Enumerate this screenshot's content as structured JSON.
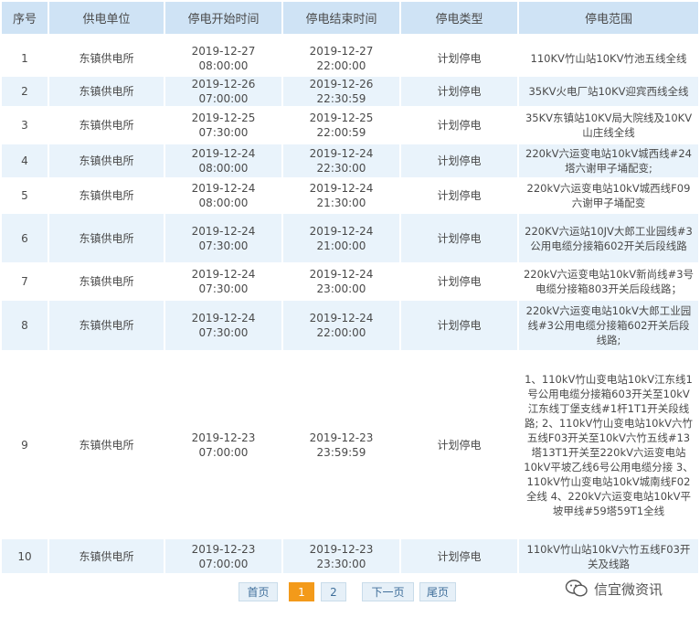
{
  "columns": [
    "序号",
    "供电单位",
    "停电开始时间",
    "停电结束时间",
    "停电类型",
    "停电范围"
  ],
  "rows": [
    {
      "no": "1",
      "unit": "东镇供电所",
      "start": "2019-12-27 08:00:00",
      "end": "2019-12-27 22:00:00",
      "type": "计划停电",
      "scope": "110KV竹山站10KV竹池五线全线"
    },
    {
      "no": "2",
      "unit": "东镇供电所",
      "start": "2019-12-26 07:00:00",
      "end": "2019-12-26 22:30:59",
      "type": "计划停电",
      "scope": "35KV火电厂站10KV迎宾西线全线"
    },
    {
      "no": "3",
      "unit": "东镇供电所",
      "start": "2019-12-25 07:30:00",
      "end": "2019-12-25 22:00:59",
      "type": "计划停电",
      "scope": "35KV东镇站10KV局大院线及10KV山庄线全线"
    },
    {
      "no": "4",
      "unit": "东镇供电所",
      "start": "2019-12-24 08:00:00",
      "end": "2019-12-24 22:30:00",
      "type": "计划停电",
      "scope": "220kV六运变电站10kV城西线#24塔六谢甲子埇配变;"
    },
    {
      "no": "5",
      "unit": "东镇供电所",
      "start": "2019-12-24 08:00:00",
      "end": "2019-12-24 21:30:00",
      "type": "计划停电",
      "scope": "220kV六运变电站10kV城西线F09六谢甲子埇配变"
    },
    {
      "no": "6",
      "unit": "东镇供电所",
      "start": "2019-12-24 07:30:00",
      "end": "2019-12-24 21:00:00",
      "type": "计划停电",
      "scope": "220KV六运站10JV大郎工业园线#3公用电缆分接箱602开关后段线路"
    },
    {
      "no": "7",
      "unit": "东镇供电所",
      "start": "2019-12-24 07:30:00",
      "end": "2019-12-24 23:00:00",
      "type": "计划停电",
      "scope": "220kV六运变电站10kV新尚线#3号电缆分接箱803开关后段线路；"
    },
    {
      "no": "8",
      "unit": "东镇供电所",
      "start": "2019-12-24 07:30:00",
      "end": "2019-12-24 22:00:00",
      "type": "计划停电",
      "scope": "220kV六运变电站10kV大郎工业园线#3公用电缆分接箱602开关后段线路;"
    },
    {
      "no": "9",
      "unit": "东镇供电所",
      "start": "2019-12-23 07:00:00",
      "end": "2019-12-23 23:59:59",
      "type": "计划停电",
      "scope": "1、110kV竹山变电站10kV江东线1号公用电缆分接箱603开关至10kV江东线丁堡支线#1杆1T1开关段线路; 2、110kV竹山变电站10kV六竹五线F03开关至10kV六竹五线#13塔13T1开关至220kV六运变电站10kV平坡乙线6号公用电缆分接 3、110kV竹山变电站10kV城南线F02全线 4、220kV六运变电站10kV平坡甲线#59塔59T1全线"
    },
    {
      "no": "10",
      "unit": "东镇供电所",
      "start": "2019-12-23 07:00:00",
      "end": "2019-12-23 23:30:00",
      "type": "计划停电",
      "scope": "110kV竹山站10kV六竹五线F03开关及线路"
    }
  ],
  "pagination": {
    "first": "首页",
    "page1": "1",
    "page2": "2",
    "next": "下一页",
    "last": "尾页"
  },
  "watermark": {
    "text": "信宜微资讯",
    "icon": "wechat-like-icon"
  }
}
